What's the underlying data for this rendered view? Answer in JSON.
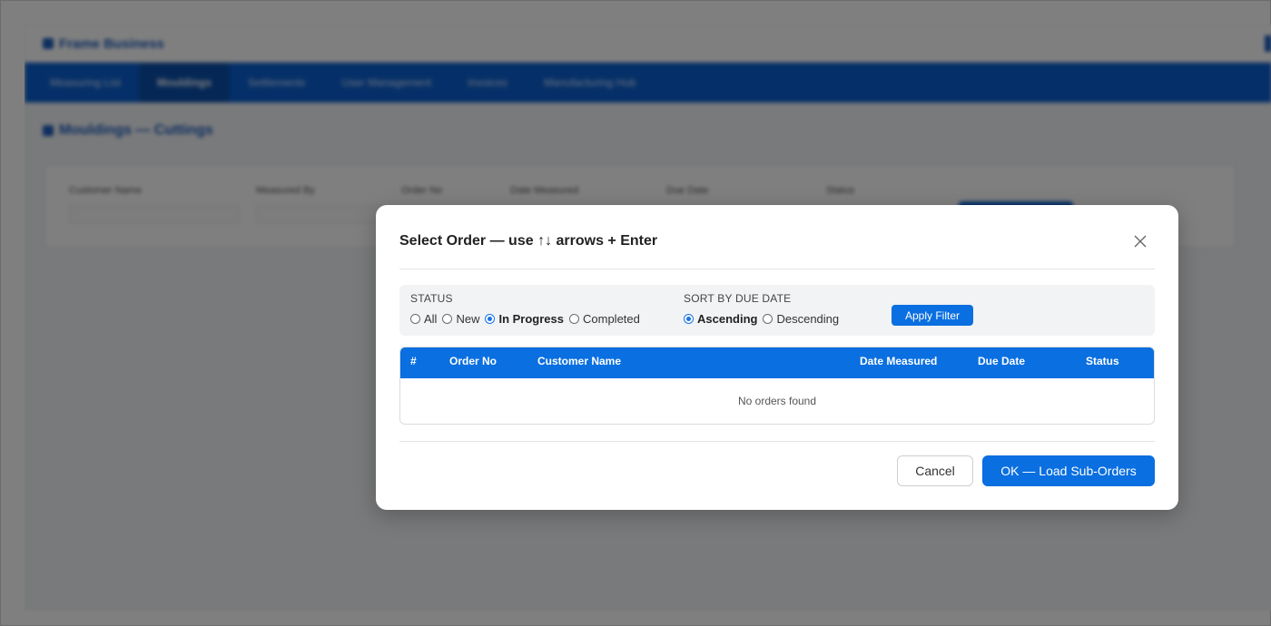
{
  "app": {
    "title": "Frame Business",
    "nav": [
      "Measuring List",
      "Mouldings",
      "Settlements",
      "User Management",
      "Invoices",
      "Manufacturing Hub"
    ],
    "active_nav_index": 1,
    "page_heading": "Mouldings — Cuttings",
    "filter_labels": [
      "Customer Name",
      "Measured By",
      "Order No",
      "Date Measured",
      "Due Date",
      "Status"
    ]
  },
  "modal": {
    "title": "Select Order — use ↑↓ arrows + Enter",
    "close_icon": "close-icon",
    "status": {
      "label": "STATUS",
      "options": [
        "All",
        "New",
        "In Progress",
        "Completed"
      ],
      "selected": "In Progress"
    },
    "sort": {
      "label": "SORT BY DUE DATE",
      "options": [
        "Ascending",
        "Descending"
      ],
      "selected": "Ascending"
    },
    "apply_label": "Apply Filter",
    "table": {
      "columns": [
        "#",
        "Order No",
        "Customer Name",
        "Date Measured",
        "Due Date",
        "Status"
      ],
      "rows": [],
      "empty_text": "No orders found"
    },
    "cancel_label": "Cancel",
    "ok_label": "OK — Load Sub-Orders"
  },
  "colors": {
    "primary": "#0a6fe0",
    "nav_bg": "#0a5fd0",
    "overlay": "rgba(0,0,0,0.5)"
  }
}
